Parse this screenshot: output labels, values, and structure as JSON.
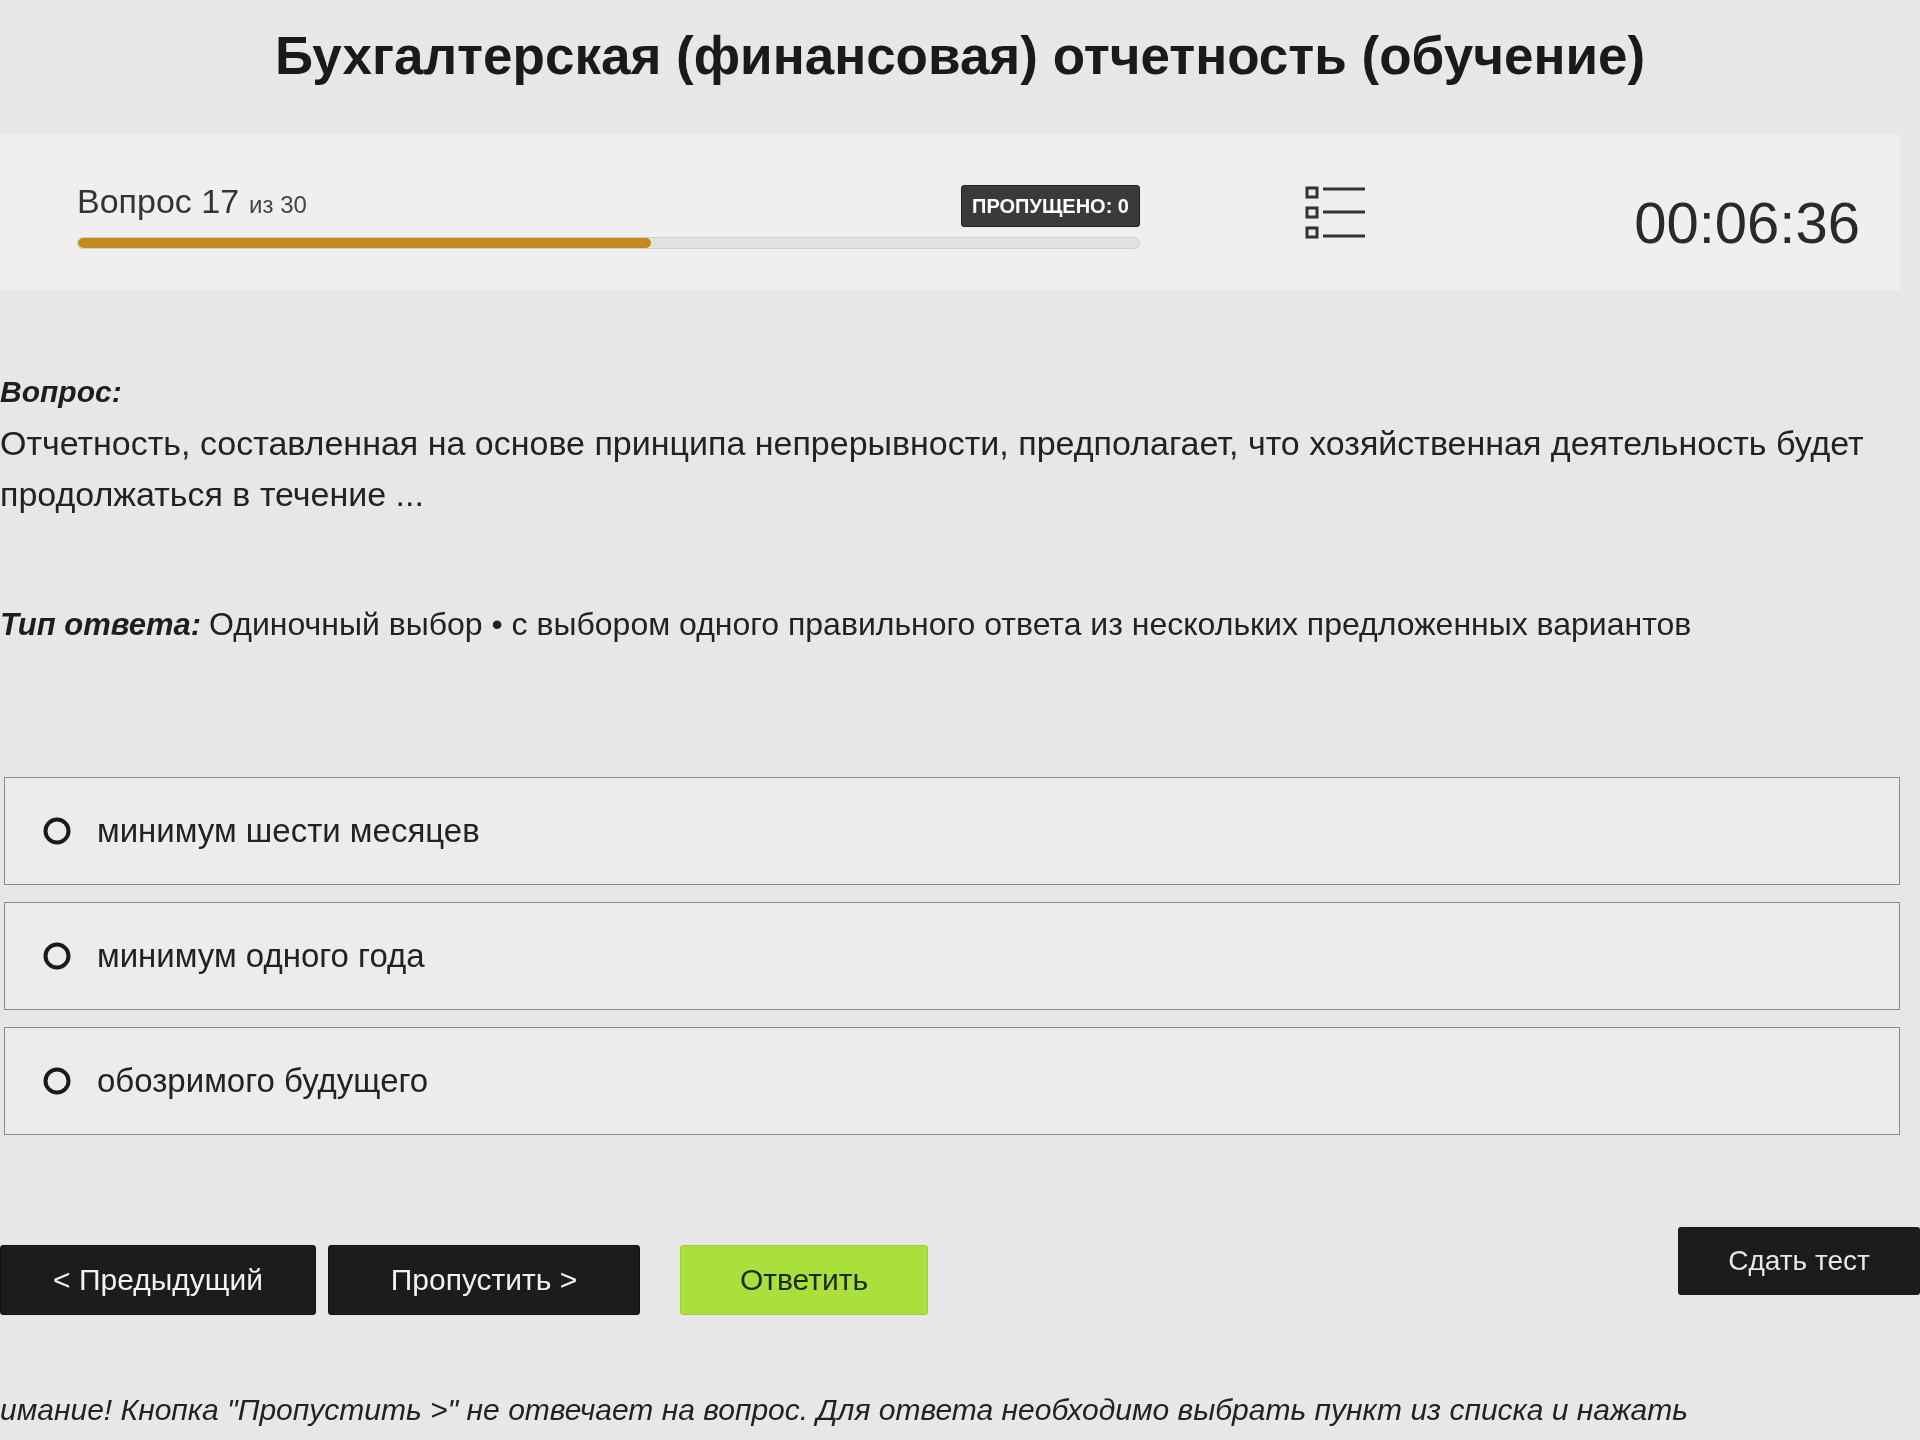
{
  "title": "Бухгалтерская (финансовая) отчетность (обучение)",
  "progress": {
    "question_label": "Вопрос 17",
    "total_label": "из 30",
    "level": 0.54,
    "skipped_badge": "ПРОПУЩЕНО: 0",
    "timer": "00:06:36"
  },
  "question": {
    "heading": "Вопрос:",
    "text": "Отчетность, составленная на основе принципа непрерывности, предполагает, что хозяйственная деятельность будет продолжаться в течение ...",
    "answer_type_label": "Тип ответа:",
    "answer_type": "Одиночный выбор • с выбором одного правильного ответа из нескольких предложенных вариантов"
  },
  "options": [
    {
      "label": "минимум шести месяцев",
      "selected": false
    },
    {
      "label": "минимум одного года",
      "selected": false
    },
    {
      "label": "обозримого будущего",
      "selected": false
    }
  ],
  "buttons": [
    {
      "label": "< Предыдущий",
      "kind": "dark"
    },
    {
      "label": "Пропустить >",
      "kind": "dark"
    },
    {
      "label": "Ответить",
      "kind": "primary"
    }
  ],
  "submit_button": {
    "label": "Сдать тест"
  },
  "notice": "имание! Кнопка \"Пропустить >\" не отвечает на вопрос. Для ответа необходимо выбрать пункт из списка и нажать"
}
